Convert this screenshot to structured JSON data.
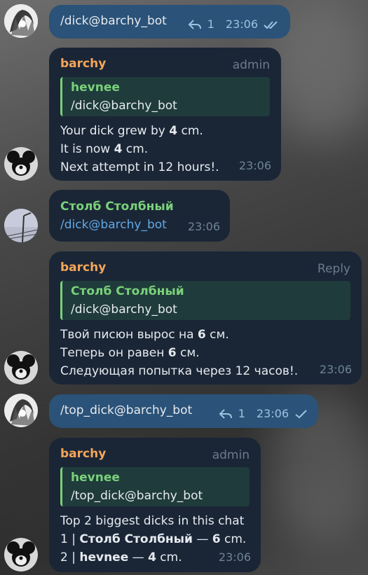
{
  "messages": [
    {
      "type": "out",
      "text": "/dick@barchy_bot",
      "reply_count": "1",
      "time": "23:06",
      "status": "read"
    },
    {
      "type": "in",
      "sender": "barchy",
      "role": "admin",
      "quote_name": "hevnee",
      "quote_text": "/dick@barchy_bot",
      "lines": [
        {
          "pre": "Your dick grew by ",
          "bold": "4",
          "post": " cm."
        },
        {
          "pre": "It is now ",
          "bold": "4",
          "post": " cm."
        },
        {
          "pre": "Next attempt in 12 hours!.",
          "bold": "",
          "post": ""
        }
      ],
      "time": "23:06"
    },
    {
      "type": "in",
      "sender": "Столб Столбный",
      "text": "/dick@barchy_bot",
      "time": "23:06"
    },
    {
      "type": "in",
      "sender": "barchy",
      "role": "Reply",
      "quote_name": "Столб Столбный",
      "quote_text": "/dick@barchy_bot",
      "lines": [
        {
          "pre": "Твой писюн вырос на ",
          "bold": "6",
          "post": " см."
        },
        {
          "pre": "Теперь он равен ",
          "bold": "6",
          "post": " см."
        },
        {
          "pre": "Следующая попытка через 12 часов!.",
          "bold": "",
          "post": ""
        }
      ],
      "time": "23:06"
    },
    {
      "type": "out",
      "text": "/top_dick@barchy_bot",
      "reply_count": "1",
      "time": "23:06",
      "status": "sent"
    },
    {
      "type": "in",
      "sender": "barchy",
      "role": "admin",
      "quote_name": "hevnee",
      "quote_text": "/top_dick@barchy_bot",
      "lines": [
        {
          "pre": "Top 2 biggest dicks in this chat",
          "bold": "",
          "post": ""
        },
        {
          "pre": "1 | ",
          "bold": "Столб Столбный",
          "post": " — ",
          "bold2": "6",
          "post2": " cm."
        },
        {
          "pre": "2 | ",
          "bold": "hevnee",
          "post": " — ",
          "bold2": "4",
          "post2": " cm."
        }
      ],
      "time": "23:06"
    }
  ],
  "colors": {
    "incoming_bubble": "#1a2636",
    "outgoing_bubble": "#2b5278",
    "sender_bot": "#f5a55a",
    "sender_user": "#7ad17a",
    "command_link": "#62a8e5"
  },
  "icons": {
    "reply": "reply-arrow-icon",
    "read": "double-check-icon",
    "sent": "single-check-icon"
  }
}
